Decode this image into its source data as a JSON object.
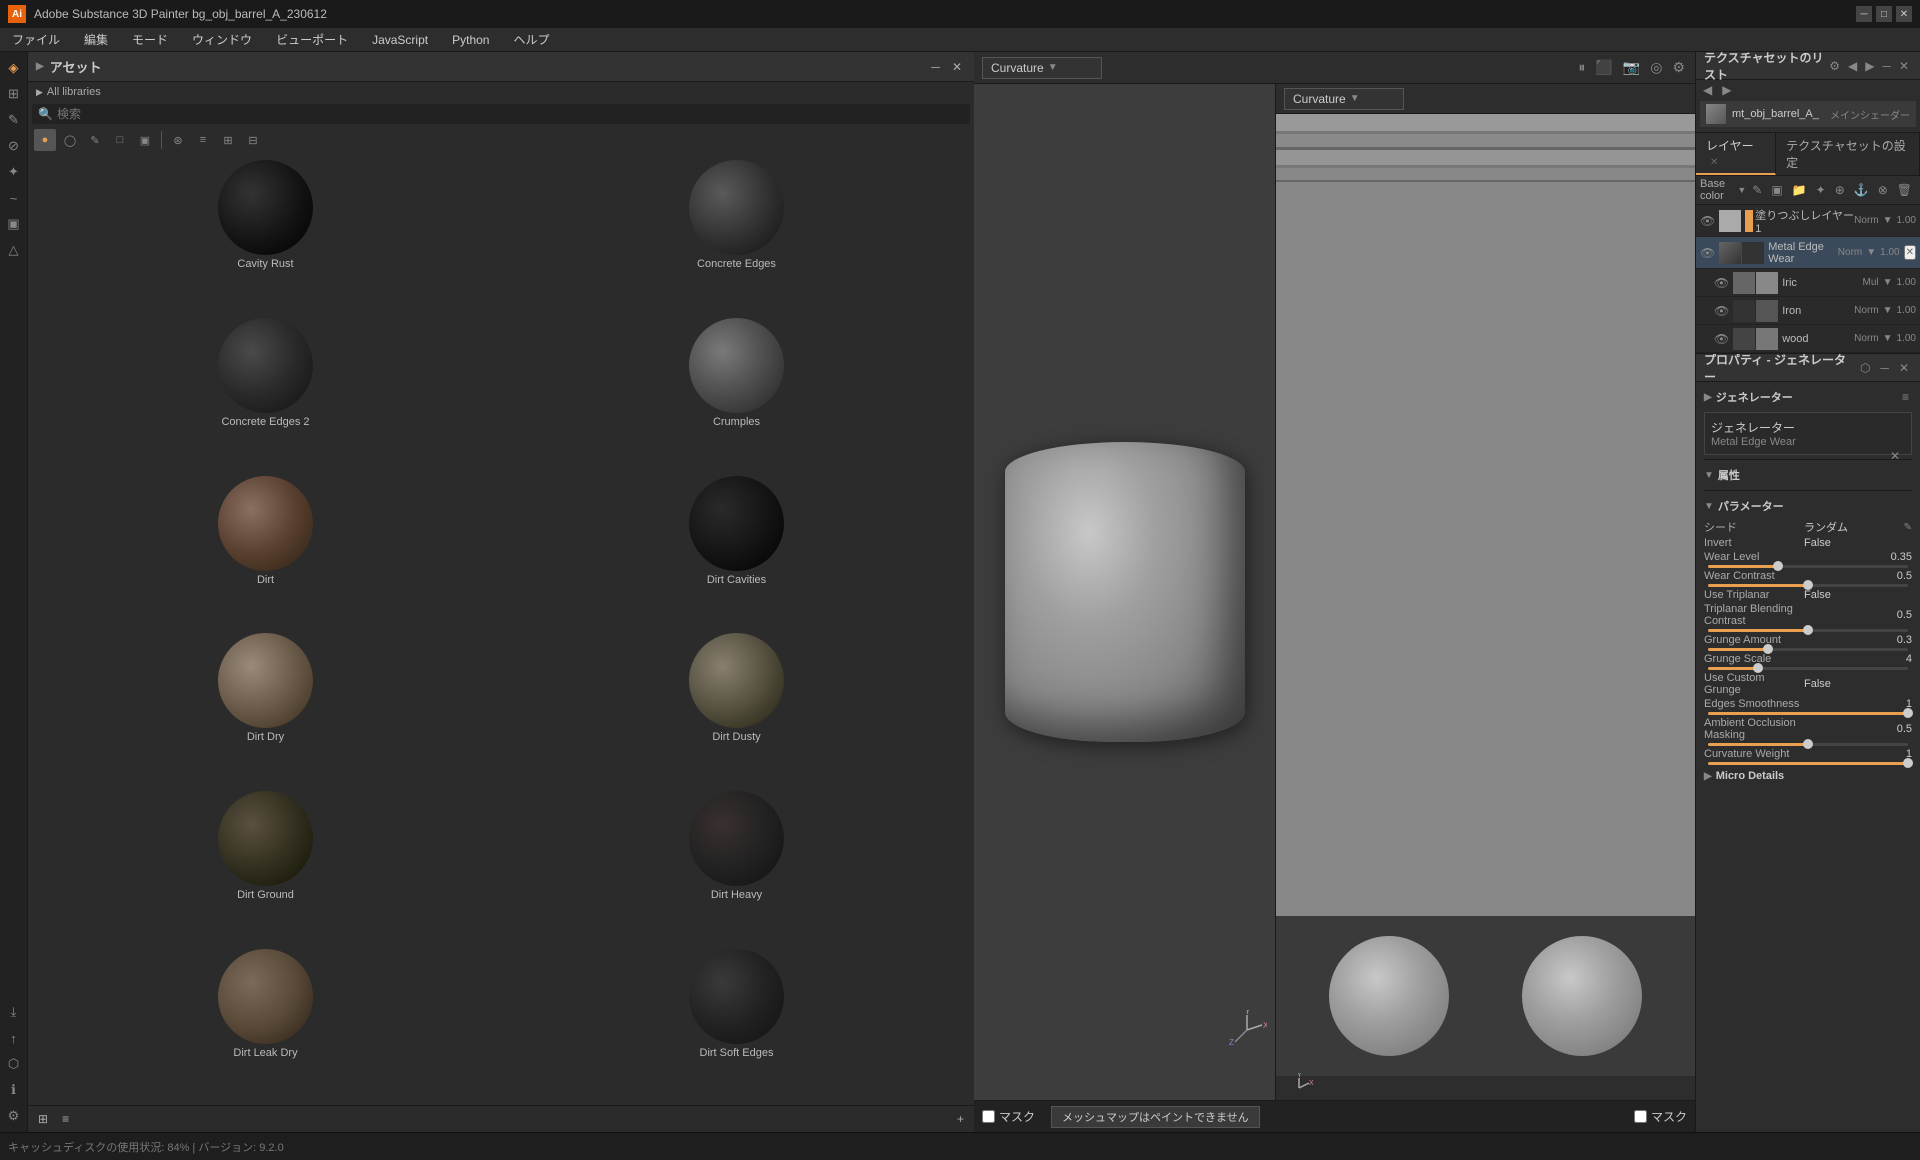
{
  "window": {
    "title": "Adobe Substance 3D Painter bg_obj_barrel_A_230612",
    "minimize": "─",
    "maximize": "□",
    "close": "✕"
  },
  "menu": {
    "items": [
      "ファイル",
      "編集",
      "モード",
      "ウィンドウ",
      "ビューポート",
      "JavaScript",
      "Python",
      "ヘルプ"
    ]
  },
  "assets_panel": {
    "title": "アセット",
    "breadcrumb": "All libraries",
    "search_placeholder": "検索",
    "filter_icons": [
      "circle",
      "pen",
      "square",
      "image",
      "grid-circle",
      "list",
      "grid",
      "apps"
    ],
    "items": [
      {
        "name": "Cavity Rust",
        "mat": "mat-cavity-rust"
      },
      {
        "name": "Concrete Edges",
        "mat": "mat-concrete-edges"
      },
      {
        "name": "Concrete Edges 2",
        "mat": "mat-concrete-edges2"
      },
      {
        "name": "Crumples",
        "mat": "mat-crumples"
      },
      {
        "name": "Dirt",
        "mat": "mat-dirt"
      },
      {
        "name": "Dirt Cavities",
        "mat": "mat-dirt-cavities"
      },
      {
        "name": "Dirt Dry",
        "mat": "mat-dirt-dry"
      },
      {
        "name": "Dirt Dusty",
        "mat": "mat-dirt-dusty"
      },
      {
        "name": "Dirt Ground",
        "mat": "mat-dirt-ground"
      },
      {
        "name": "Dirt Heavy",
        "mat": "mat-dirt-heavy"
      },
      {
        "name": "Dirt Leak Dry",
        "mat": "mat-dirt-leak-dry"
      },
      {
        "name": "Dirt Soft Edges",
        "mat": "mat-dirt-soft-edges"
      }
    ],
    "bottom_icons": [
      "grid-2x2",
      "list-view",
      "plus"
    ]
  },
  "viewport_left": {
    "dropdown": "Curvature",
    "controls": [
      "pause",
      "3d",
      "camera",
      "render",
      "settings"
    ]
  },
  "viewport_right": {
    "dropdown": "Curvature"
  },
  "texture_set_panel": {
    "title": "テクスチャセットのリスト",
    "settings_label": "設定",
    "item_name": "mt_obj_barrel_A_",
    "item_tag": "メインシェーダー"
  },
  "layers_panel": {
    "tabs": [
      "レイヤー",
      "テクスチャセットの設定"
    ],
    "active_tab": "レイヤー",
    "blend_mode": "Base color",
    "toolbar_icons": [
      "eye",
      "lock",
      "fx",
      "folder",
      "brush",
      "filter",
      "fill",
      "merge"
    ],
    "layers": [
      {
        "name": "塗りつぶしレイヤー 1",
        "blend": "Norm",
        "opacity": "1.00",
        "visible": true,
        "type": "fill"
      },
      {
        "name": "Metal Edge Wear",
        "blend": "Norm",
        "opacity": "1.00",
        "visible": true,
        "type": "effect",
        "selected": true
      },
      {
        "name": "Iric",
        "blend": "Mul",
        "opacity": "1.00",
        "visible": true,
        "type": "sub"
      },
      {
        "name": "Iron",
        "blend": "Norm",
        "opacity": "1.00",
        "visible": true,
        "type": "sub"
      },
      {
        "name": "wood",
        "blend": "Norm",
        "opacity": "1.00",
        "visible": true,
        "type": "sub"
      }
    ]
  },
  "generator_panel": {
    "title": "プロパティ - ジェネレーター",
    "section_generator": "ジェネレーター",
    "generator_name": "ジェネレーター",
    "generator_subname": "Metal Edge Wear",
    "properties_title": "属性",
    "params_title": "パラメーター",
    "params": {
      "seed_label": "シード",
      "seed_value": "ランダム",
      "invert_label": "Invert",
      "invert_value": "False",
      "wear_level_label": "Wear Level",
      "wear_level_value": "0.35",
      "wear_level_pct": 35,
      "wear_contrast_label": "Wear Contrast",
      "wear_contrast_value": "0.5",
      "wear_contrast_pct": 50,
      "use_triplanar_label": "Use Triplanar",
      "use_triplanar_value": "False",
      "triplanar_blend_label": "Triplanar Blending Contrast",
      "triplanar_blend_value": "0.5",
      "triplanar_blend_pct": 50,
      "grunge_amount_label": "Grunge Amount",
      "grunge_amount_value": "0.3",
      "grunge_amount_pct": 30,
      "grunge_scale_label": "Grunge Scale",
      "grunge_scale_value": "4",
      "grunge_scale_pct": 25,
      "use_custom_grunge_label": "Use Custom Grunge",
      "use_custom_grunge_value": "False",
      "edges_smoothness_label": "Edges Smoothness",
      "edges_smoothness_value": "1",
      "edges_smoothness_pct": 100,
      "ambient_occlusion_label": "Ambient Occlusion Masking",
      "ambient_occlusion_value": "0.5",
      "ambient_occlusion_pct": 50,
      "curvature_weight_label": "Curvature Weight",
      "curvature_weight_value": "1",
      "curvature_weight_pct": 100
    },
    "micro_details_title": "Micro Details"
  },
  "status_bar": {
    "mask_label": "マスク",
    "message": "メッシュマップはペイントできません",
    "mask_right_label": "マスク",
    "cache_info": "キャッシュディスクの使用状況: 84% | バージョン: 9.2.0"
  }
}
